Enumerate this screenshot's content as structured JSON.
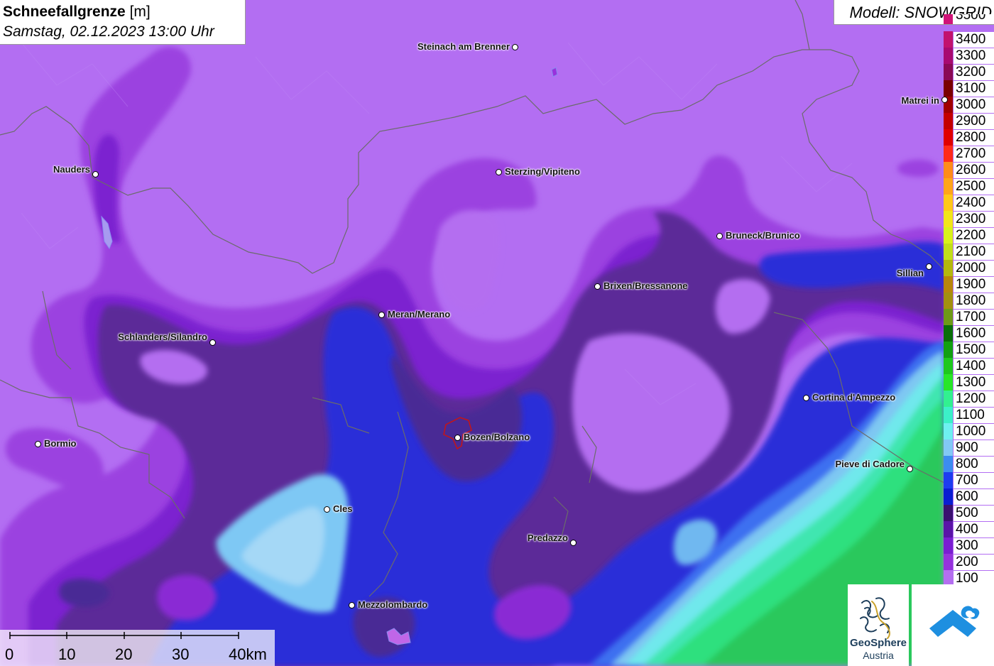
{
  "header": {
    "title_bold": "Schneefallgrenze",
    "title_unit": " [m]",
    "datetime": "Samstag, 02.12.2023 13:00 Uhr"
  },
  "model": {
    "label": "Modell: SNOWGRID"
  },
  "legend": {
    "unit": "m",
    "entries": [
      {
        "value": "3400",
        "color": "#c2126e"
      },
      {
        "value": "3300",
        "color": "#a80a70"
      },
      {
        "value": "3200",
        "color": "#8a0a55"
      },
      {
        "value": "3100",
        "color": "#7a0000"
      },
      {
        "value": "3000",
        "color": "#a00000"
      },
      {
        "value": "2900",
        "color": "#c40000"
      },
      {
        "value": "2800",
        "color": "#e00000"
      },
      {
        "value": "2700",
        "color": "#ff2a1a"
      },
      {
        "value": "2600",
        "color": "#ff8c1a"
      },
      {
        "value": "2500",
        "color": "#ffa51a"
      },
      {
        "value": "2400",
        "color": "#ffc81a"
      },
      {
        "value": "2300",
        "color": "#f2e61a"
      },
      {
        "value": "2200",
        "color": "#d9f21a"
      },
      {
        "value": "2100",
        "color": "#c2de1a"
      },
      {
        "value": "2000",
        "color": "#b4b80e"
      },
      {
        "value": "1900",
        "color": "#b8860b"
      },
      {
        "value": "1800",
        "color": "#a39010"
      },
      {
        "value": "1700",
        "color": "#6e9a18"
      },
      {
        "value": "1600",
        "color": "#0a6e0a"
      },
      {
        "value": "1500",
        "color": "#12a012"
      },
      {
        "value": "1400",
        "color": "#1ec81e"
      },
      {
        "value": "1300",
        "color": "#28e628"
      },
      {
        "value": "1200",
        "color": "#32f090"
      },
      {
        "value": "1100",
        "color": "#3cf0c8"
      },
      {
        "value": "1000",
        "color": "#6ef0f0"
      },
      {
        "value": "900",
        "color": "#82c8f5"
      },
      {
        "value": "800",
        "color": "#3c8cf0"
      },
      {
        "value": "700",
        "color": "#1e3cf0"
      },
      {
        "value": "600",
        "color": "#0a1ed2"
      },
      {
        "value": "500",
        "color": "#3a1070"
      },
      {
        "value": "400",
        "color": "#5a14a8"
      },
      {
        "value": "300",
        "color": "#7a1ed2"
      },
      {
        "value": "200",
        "color": "#9632dc"
      },
      {
        "value": "100",
        "color": "#b46ef0"
      }
    ],
    "top_partial": "3500"
  },
  "places": [
    {
      "name": "Steinach am Brenner",
      "label_side": "left"
    },
    {
      "name": "Matrei in",
      "label_side": "left"
    },
    {
      "name": "Nauders",
      "label_side": "left"
    },
    {
      "name": "Sterzing/Vipiteno",
      "label_side": "right"
    },
    {
      "name": "Bruneck/Brunico",
      "label_side": "right"
    },
    {
      "name": "Sillian",
      "label_side": "left"
    },
    {
      "name": "Brixen/Bressanone",
      "label_side": "right"
    },
    {
      "name": "Meran/Merano",
      "label_side": "right"
    },
    {
      "name": "Schlanders/Silandro",
      "label_side": "left"
    },
    {
      "name": "Cortina d'Ampezzo",
      "label_side": "right"
    },
    {
      "name": "Bormio",
      "label_side": "right"
    },
    {
      "name": "Bozen/Bolzano",
      "label_side": "right"
    },
    {
      "name": "Pieve di Cadore",
      "label_side": "left"
    },
    {
      "name": "Cles",
      "label_side": "right"
    },
    {
      "name": "Predazzo",
      "label_side": "left"
    },
    {
      "name": "Mezzolombardo",
      "label_side": "right"
    }
  ],
  "scalebar": {
    "ticks": [
      "0",
      "10",
      "20",
      "30",
      "40km"
    ]
  },
  "logos": {
    "geosphere_line1": "GeoSphere",
    "geosphere_line2": "Austria"
  },
  "colors": {
    "map_base": "#b36ef2",
    "band_200": "#9a3fdf",
    "band_300": "#8a28d6",
    "band_500": "#5b2a9a",
    "band_600": "#2a2bd6",
    "band_900": "#7ec7f2",
    "band_1000": "#6fe8ec",
    "band_1200": "#40e6a8",
    "band_1400": "#2fd066",
    "border_line": "#6b6b6b"
  }
}
